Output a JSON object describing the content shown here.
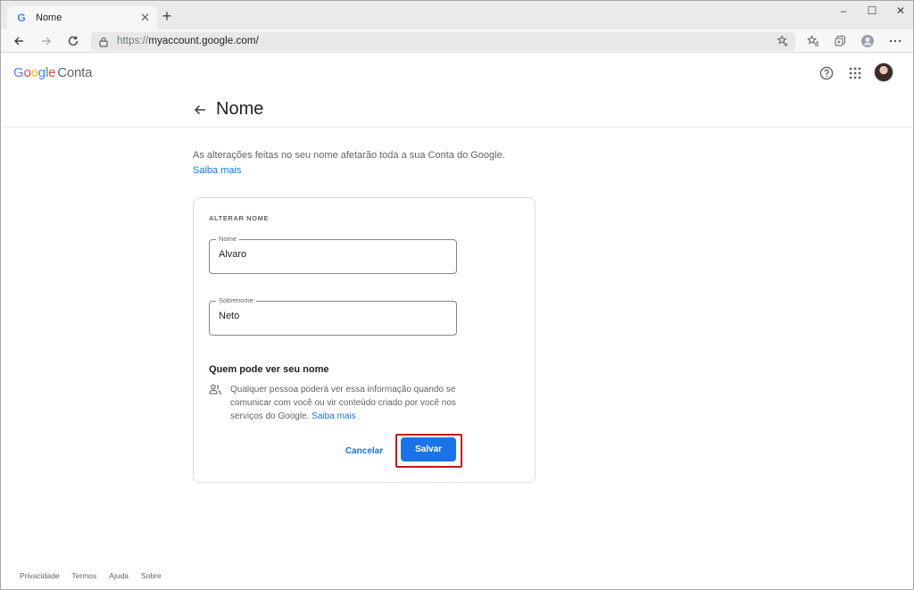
{
  "browser": {
    "tab_title": "Nome",
    "tab_favicon": "G",
    "url_scheme": "https://",
    "url_host": "myaccount.google.com/",
    "window_controls": [
      "–",
      "☐",
      "✕"
    ]
  },
  "appbar": {
    "brand_letters": [
      "G",
      "o",
      "o",
      "g",
      "l",
      "e"
    ],
    "brand_product": "Conta",
    "icons": [
      "help-icon",
      "apps-grid-icon",
      "avatar"
    ]
  },
  "page": {
    "title": "Nome",
    "intro_text": "As alterações feitas no seu nome afetarão toda a sua Conta do Google.",
    "intro_link": "Saiba mais"
  },
  "card": {
    "heading": "ALTERAR NOME",
    "first_name_label": "Nome",
    "first_name_value": "Alvaro",
    "last_name_label": "Sobrenome",
    "last_name_value": "Neto",
    "who_title": "Quem pode ver seu nome",
    "who_text": "Qualquer pessoa poderá ver essa informação quando se comunicar com você ou vir conteúdo criado por você nos serviços do Google.",
    "who_link": "Saiba mais",
    "cancel_label": "Cancelar",
    "save_label": "Salvar"
  },
  "footer": {
    "links": [
      "Privacidade",
      "Termos",
      "Ajuda",
      "Sobre"
    ]
  },
  "colors": {
    "accent": "#1a73e8",
    "highlight_border": "#c5161d",
    "google_blue": "#4285f4",
    "google_red": "#ea4335",
    "google_yellow": "#fbbc05",
    "google_green": "#34a853"
  }
}
